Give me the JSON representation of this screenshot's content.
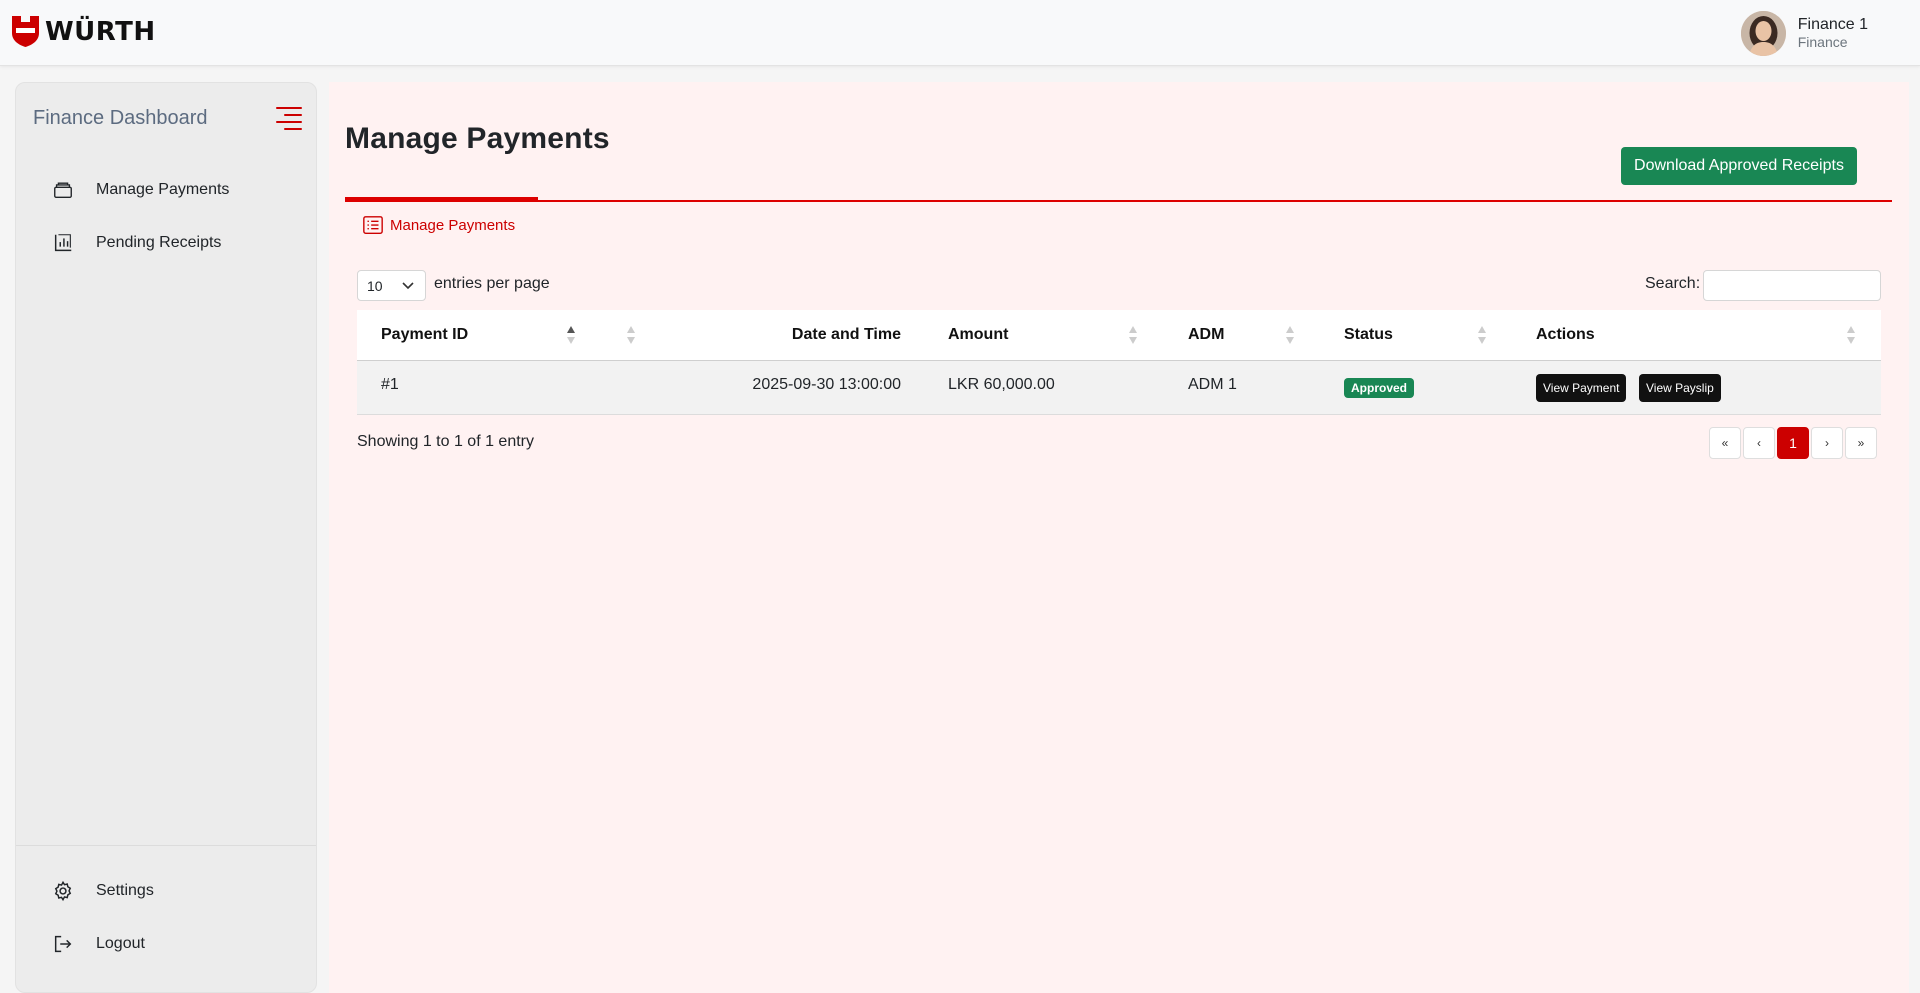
{
  "brand": {
    "name": "WÜRTH",
    "color": "#cc0000"
  },
  "user": {
    "name": "Finance 1",
    "role": "Finance"
  },
  "sidebar": {
    "title": "Finance Dashboard",
    "items": [
      {
        "label": "Manage Payments",
        "icon": "wallet-icon"
      },
      {
        "label": "Pending Receipts",
        "icon": "report-chart-icon"
      }
    ],
    "bottom_items": [
      {
        "label": "Settings",
        "icon": "gear-icon"
      },
      {
        "label": "Logout",
        "icon": "logout-icon"
      }
    ]
  },
  "main": {
    "title": "Manage Payments",
    "download_button": "Download Approved Receipts",
    "tab_label": "Manage Payments"
  },
  "table_controls": {
    "page_length": "10",
    "length_label": "entries per page",
    "search_label": "Search:",
    "search_value": ""
  },
  "table": {
    "columns": [
      "Payment ID",
      "Date and Time",
      "Amount",
      "ADM",
      "Status",
      "Actions"
    ],
    "rows": [
      {
        "payment_id": "#1",
        "date_time": "2025-09-30 13:00:00",
        "amount": "LKR 60,000.00",
        "adm": "ADM 1",
        "status": "Approved",
        "actions": [
          "View Payment",
          "View Payslip"
        ]
      }
    ]
  },
  "footer": {
    "info": "Showing 1 to 1 of 1 entry",
    "pagination": {
      "first": "«",
      "prev": "‹",
      "current": "1",
      "next": "›",
      "last": "»"
    }
  },
  "colors": {
    "accent": "#cc0000",
    "success": "#198754",
    "main_bg": "#fff2f2"
  }
}
